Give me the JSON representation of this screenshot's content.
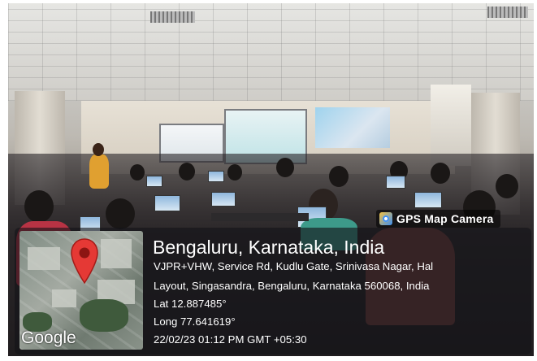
{
  "badge": {
    "label": "GPS Map Camera",
    "icon": "gps-map-camera-icon"
  },
  "location": {
    "title": "Bengaluru, Karnataka, India",
    "address_line1": "VJPR+VHW, Service Rd, Kudlu Gate, Srinivasa Nagar, Hal",
    "address_line2": "Layout, Singasandra, Bengaluru, Karnataka 560068, India",
    "lat": "Lat 12.887485°",
    "long": "Long 77.641619°",
    "timestamp": "22/02/23 01:12 PM GMT +05:30"
  },
  "map": {
    "attribution": "Google",
    "pin_icon": "map-pin-icon",
    "pin_color": "#e53935"
  }
}
